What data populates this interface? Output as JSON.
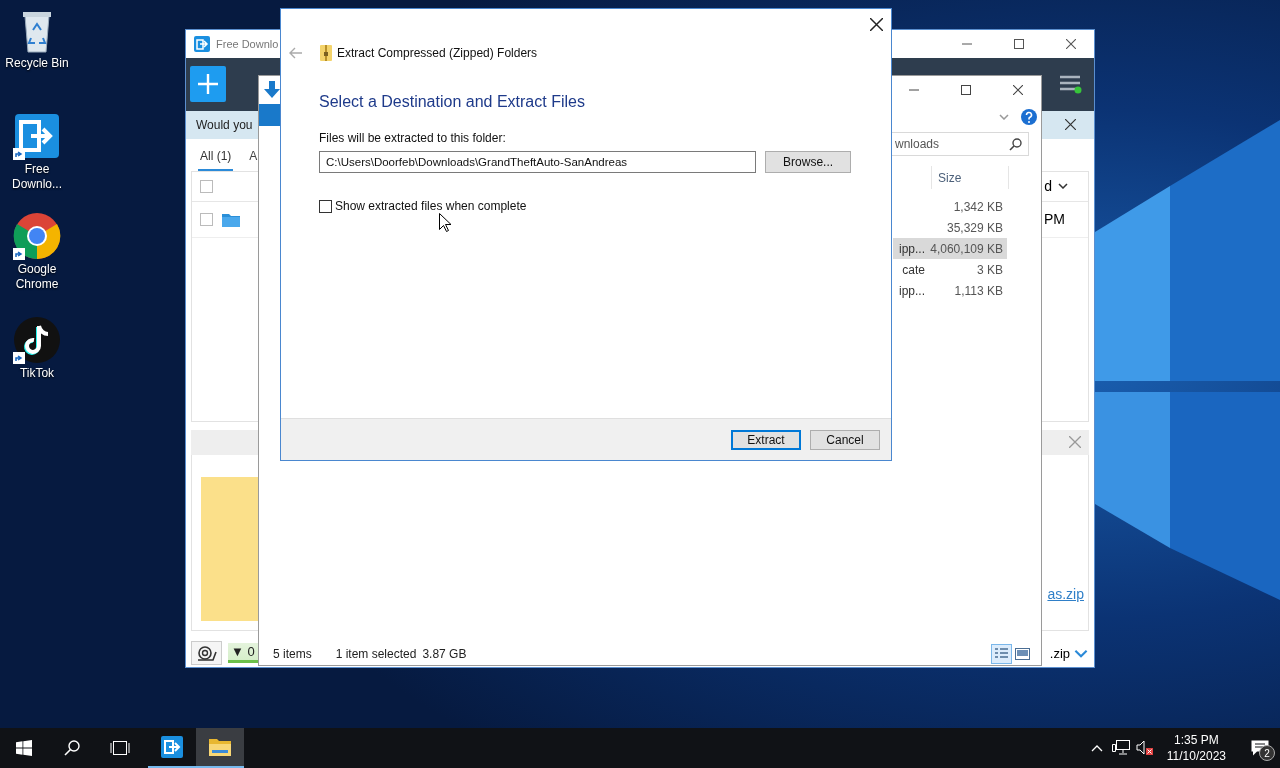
{
  "desktop_icons": [
    {
      "label": "Recycle Bin",
      "kind": "bin"
    },
    {
      "label": "Free Downlo...",
      "kind": "downloader"
    },
    {
      "label": "Google Chrome",
      "kind": "browser"
    },
    {
      "label": "TikTok",
      "kind": "music"
    }
  ],
  "downloader_window": {
    "title": "Free Downlo",
    "banner": "Would you",
    "tabs": [
      {
        "label": "All (1)",
        "selected": true
      },
      {
        "label": "A",
        "selected": false
      }
    ],
    "list_header": {
      "label": "d",
      "checked": false
    },
    "download_row": {
      "time": "PM",
      "checked": false
    },
    "link": "as.zip",
    "speed_count": "▼ 0",
    "bottom_file": ".zip"
  },
  "explorer_window": {
    "search": "wnloads",
    "size_column": "Size",
    "rows": [
      {
        "size": "1,342 KB",
        "selected": false
      },
      {
        "size": "35,329 KB",
        "selected": false
      },
      {
        "name": "ipp...",
        "size": "4,060,109 KB",
        "selected": true
      },
      {
        "name": "cate",
        "size": "3 KB",
        "selected": false
      },
      {
        "name": "ipp...",
        "size": "1,113 KB",
        "selected": false
      }
    ],
    "status_items": "5 items",
    "status_selected": "1 item selected",
    "status_size": "3.87 GB"
  },
  "dialog": {
    "title": "Extract Compressed (Zipped) Folders",
    "heading": "Select a Destination and Extract Files",
    "folder_label": "Files will be extracted to this folder:",
    "path": "C:\\Users\\Doorfeb\\Downloads\\GrandTheftAuto-SanAndreas",
    "browse": "Browse...",
    "show_files": {
      "label": "Show extracted files when complete",
      "checked": false
    },
    "buttons": [
      {
        "label": "Extract",
        "default": true
      },
      {
        "label": "Cancel",
        "default": false
      }
    ]
  },
  "taskbar": {
    "apps": [
      {
        "kind": "downloader",
        "active": false
      },
      {
        "kind": "explorer",
        "active": true
      }
    ],
    "time": "1:35 PM",
    "date": "11/10/2023",
    "notifications": "2"
  }
}
